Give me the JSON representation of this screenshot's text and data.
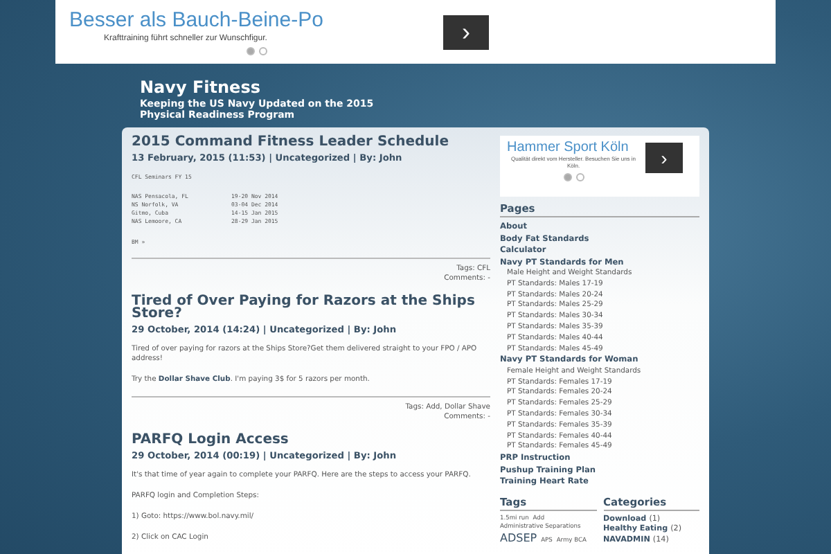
{
  "top_ad": {
    "headline": "Besser als Bauch-Beine-Po",
    "text": "Krafttraining führt schneller zur Wunschfigur.",
    "next": "›",
    "dots": [
      {
        "selected": true
      },
      {
        "selected": false
      }
    ]
  },
  "header": {
    "title": "Navy Fitness",
    "tagline": "Keeping the US Navy Updated on the 2015 Physical Readiness Program"
  },
  "posts": [
    {
      "title": "2015 Command Fitness Leader Schedule",
      "meta": "13 February, 2015 (11:53) | Uncategorized | By: John",
      "body": [
        {
          "kind": "pre",
          "text": "CFL Seminars FY 15"
        },
        {
          "kind": "schedule",
          "rows": [
            [
              "NAS Pensacola, FL",
              "19-20 Nov 2014"
            ],
            [
              "NS Norfolk, VA",
              "03-04 Dec 2014"
            ],
            [
              "Gitmo, Cuba",
              "14-15 Jan 2015"
            ],
            [
              "NAS Lemoore, CA",
              "28-29 Jan 2015"
            ]
          ]
        },
        {
          "kind": "pre",
          "text": "BM »"
        }
      ],
      "tags": "Tags: CFL",
      "comments": "Comments: -"
    },
    {
      "title": "Tired of Over Paying for Razors at the Ships Store?",
      "meta": "29 October, 2014 (14:24) | Uncategorized | By: John",
      "body": [
        {
          "kind": "para",
          "text": "Tired of over paying for razors at the Ships Store?Get them delivered straight to your FPO / APO address!"
        },
        {
          "kind": "para",
          "text": "Try the **Dollar Shave Club**. I'm paying 3$ for 5 razors per month."
        }
      ],
      "tags": "Tags: Add, Dollar Shave",
      "comments": "Comments: -"
    },
    {
      "title": "PARFQ Login Access",
      "meta": "29 October, 2014 (00:19) | Uncategorized | By: John",
      "body": [
        {
          "kind": "para",
          "text": "It's that time of year again to complete your PARFQ. Here are the steps to access your PARFQ."
        },
        {
          "kind": "para",
          "text": "PARFQ login and Completion Steps:"
        },
        {
          "kind": "para",
          "text": "1) Goto: https://www.bol.navy.mil/"
        },
        {
          "kind": "para",
          "text": "2) Click on CAC Login"
        }
      ]
    }
  ],
  "side_ad": {
    "headline": "Hammer Sport Köln",
    "text": "Qualität direkt vom Hersteller. Besuchen Sie uns in Köln.",
    "next": "›",
    "dots": [
      {
        "selected": true
      },
      {
        "selected": false
      }
    ]
  },
  "pages": {
    "heading": "Pages",
    "items": [
      {
        "label": "About"
      },
      {
        "label": "Body Fat Standards"
      },
      {
        "label": "Calculator"
      },
      {
        "label": "Navy PT Standards for Men",
        "children": [
          {
            "label": "Male Height and Weight Standards"
          },
          {
            "label": "PT Standards: Males 17-19"
          },
          {
            "label": "PT Standards: Males 20-24"
          },
          {
            "label": "PT Standards: Males 25-29"
          },
          {
            "label": "PT Standards: Males 30-34"
          },
          {
            "label": "PT Standards: Males 35-39"
          },
          {
            "label": "PT Standards: Males 40-44"
          },
          {
            "label": "PT Standards: Males 45-49"
          }
        ]
      },
      {
        "label": "Navy PT Standards for Woman",
        "children": [
          {
            "label": "Female Height and Weight Standards"
          },
          {
            "label": "PT Standards: Females 17-19"
          },
          {
            "label": "PT Standards: Females 20-24"
          },
          {
            "label": "PT Standards: Females 25-29"
          },
          {
            "label": "PT Standards: Females 30-34"
          },
          {
            "label": "PT Standards: Females 35-39"
          },
          {
            "label": "PT Standards: Females 40-44"
          },
          {
            "label": "PT Standards: Females 45-49"
          }
        ]
      },
      {
        "label": "PRP Instruction"
      },
      {
        "label": "Pushup Training Plan"
      },
      {
        "label": "Training Heart Rate"
      }
    ]
  },
  "tags": {
    "heading": "Tags",
    "items": [
      {
        "label": "1.5mi run",
        "kind": "small"
      },
      {
        "label": "Add",
        "kind": "small"
      },
      {
        "label": "Administrative Separations",
        "kind": "small"
      },
      {
        "label": "ADSEP",
        "kind": "large"
      },
      {
        "label": "APS",
        "kind": "small"
      },
      {
        "label": "Army BCA",
        "kind": "small"
      }
    ]
  },
  "categories": {
    "heading": "Categories",
    "items": [
      {
        "label": "Download",
        "count": "(1)"
      },
      {
        "label": "Healthy Eating",
        "count": "(2)"
      },
      {
        "label": "NAVADMIN",
        "count": "(14)"
      }
    ]
  }
}
